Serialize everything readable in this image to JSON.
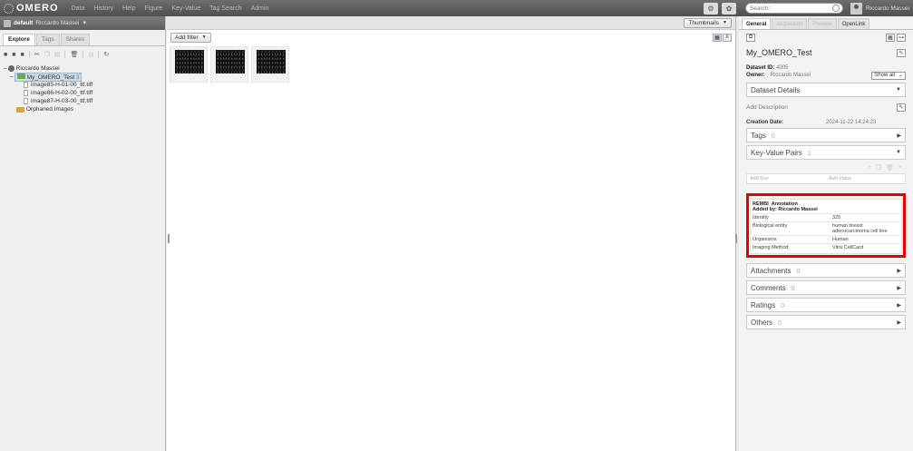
{
  "topbar": {
    "logo": "OMERO",
    "nav": [
      "Data",
      "History",
      "Help",
      "Figure",
      "Key-Value",
      "Tag Search",
      "Admin"
    ],
    "search_placeholder": "Search:",
    "user": "Riccardo Massei"
  },
  "left": {
    "group": "default",
    "group_user": "Riccardo Massei",
    "tabs": [
      "Explore",
      "Tags",
      "Shares"
    ],
    "tree": {
      "owner": "Riccardo Massei",
      "dataset": "My_OMERO_Test",
      "dataset_count": "3",
      "images": [
        "image85-H-01-00_ttf.tiff",
        "image86-H-02-00_ttf.tiff",
        "image87-H-03-00_ttf.tiff"
      ],
      "orphaned": "Orphaned Images"
    }
  },
  "center": {
    "view_mode": "Thumbnails",
    "filter_label": "Add filter",
    "thumbnail_count": 3
  },
  "right": {
    "tabs": [
      "General",
      "Acquisition",
      "Preview",
      "OpenLink"
    ],
    "title": "My_OMERO_Test",
    "dataset_id_label": "Dataset ID:",
    "dataset_id": "4005",
    "owner_label": "Owner:",
    "owner": "Riccardo Massei",
    "show_all": "Show all",
    "dataset_details": "Dataset Details",
    "add_description": "Add Description",
    "creation_label": "Creation Date:",
    "creation_date": "2024-11-22 14:24:23",
    "tags_label": "Tags",
    "tags_count": "0",
    "kv_label": "Key-Value Pairs",
    "kv_count": "1",
    "add_key": "Add Key",
    "add_value": "Add Value",
    "annotation": {
      "title": "REMBI_Annotation",
      "added_by": "Added by: Riccardo Massei",
      "rows": [
        {
          "key": "Identity",
          "value": "325"
        },
        {
          "key": "Biological entity",
          "value": "human breast adenocarcinoma cell line"
        },
        {
          "key": "Organisms",
          "value": "Human"
        },
        {
          "key": "Imaging Method",
          "value": "Vitra CellCard"
        }
      ]
    },
    "attachments_label": "Attachments",
    "attachments_count": "0",
    "comments_label": "Comments",
    "comments_count": "0",
    "ratings_label": "Ratings",
    "ratings_count": "0",
    "others_label": "Others",
    "others_count": "0"
  },
  "colors": {
    "highlight_frame": "#e60000",
    "selected_row": "#c9dbe9"
  }
}
